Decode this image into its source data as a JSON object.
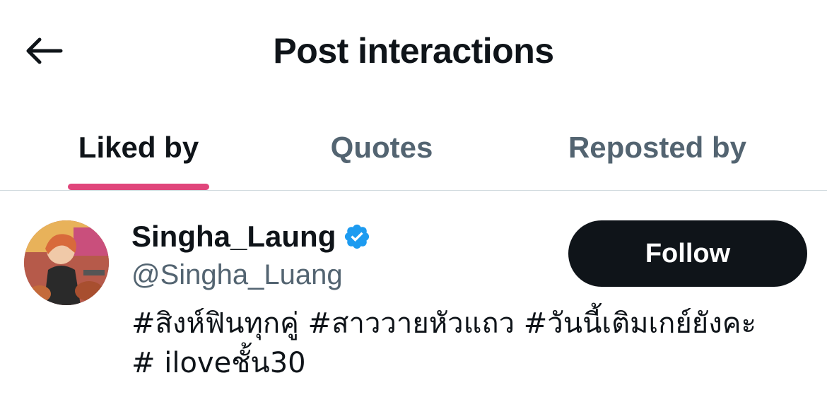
{
  "header": {
    "back_icon": "arrow-left-icon",
    "title": "Post interactions"
  },
  "tabs": [
    {
      "label": "Liked by",
      "active": true
    },
    {
      "label": "Quotes",
      "active": false
    },
    {
      "label": "Reposted by",
      "active": false
    }
  ],
  "colors": {
    "tab_indicator": "#e0457b",
    "verified_badge": "#1d9bf0",
    "follow_button_bg": "#0f1419",
    "secondary_text": "#536471"
  },
  "user": {
    "display_name": "Singha_Laung",
    "verified_icon": "verified-badge-icon",
    "handle": "@Singha_Luang",
    "follow_label": "Follow",
    "bio_lines": [
      "#สิงห์ฟินทุกคู่ #สาววายหัวแถว #วันนี้เติมเกย์ยังคะ",
      "# iloveชั้น30"
    ]
  }
}
